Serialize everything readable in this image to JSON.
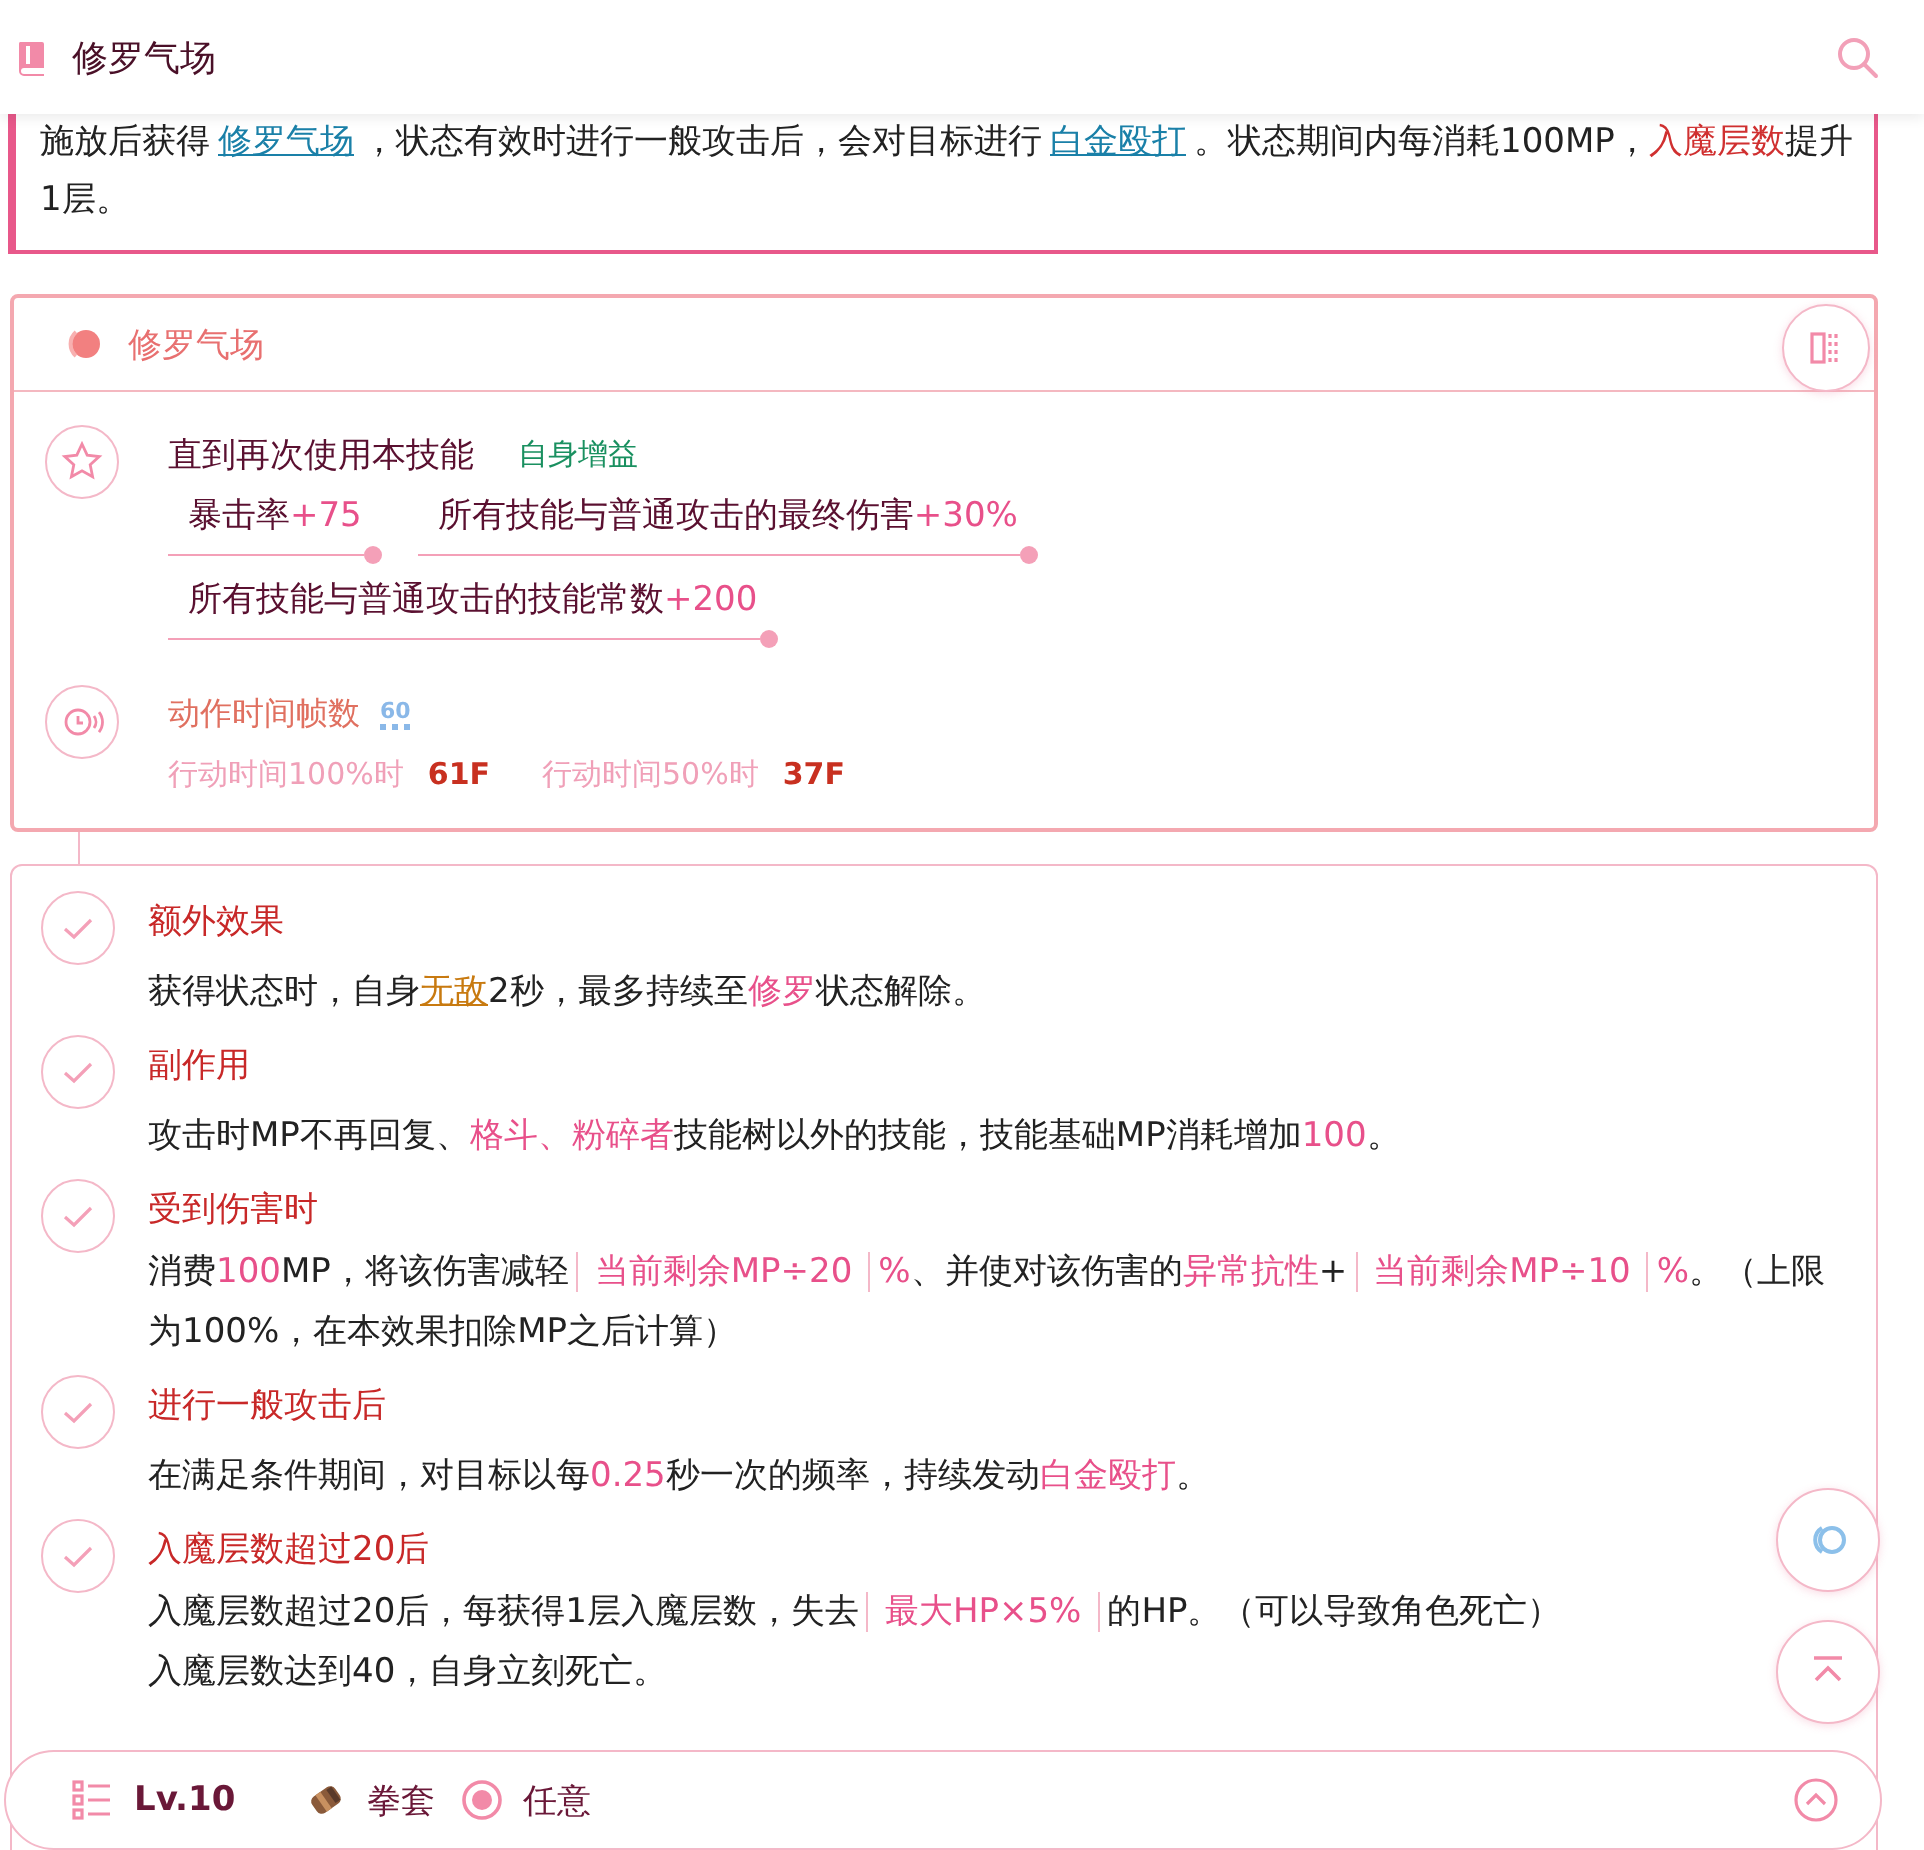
{
  "header": {
    "title": "修罗气场"
  },
  "description": [
    {
      "kind": "text",
      "text": "施放后获得"
    },
    {
      "kind": "link",
      "text": "修罗气场"
    },
    {
      "kind": "text",
      "text": "，状态有效时进行一般攻击后，会对目标进行"
    },
    {
      "kind": "link",
      "text": "白金殴打"
    },
    {
      "kind": "text",
      "text": "。状态期间内每消耗100MP，"
    },
    {
      "kind": "red",
      "text": "入魔层数"
    },
    {
      "kind": "text",
      "text": "提升1层。"
    }
  ],
  "skill_card": {
    "title": "修罗气场",
    "effect": {
      "duration": "直到再次使用本技能",
      "tag": "自身增益",
      "stats": [
        {
          "label": "暴击率",
          "value": "+75"
        },
        {
          "label": "所有技能与普通攻击的最终伤害",
          "value": "+30%"
        },
        {
          "label": "所有技能与普通攻击的技能常数",
          "value": "+200"
        }
      ]
    },
    "frames": {
      "label": "动作时间帧数",
      "badge": "60",
      "rows": [
        {
          "label": "行动时间100%时",
          "value": "61F"
        },
        {
          "label": "行动时间50%时",
          "value": "37F"
        }
      ]
    }
  },
  "details": [
    {
      "title": "额外效果",
      "lines": [
        [
          {
            "kind": "text",
            "text": "获得状态时，自身"
          },
          {
            "kind": "warn-link",
            "text": "无敌"
          },
          {
            "kind": "text",
            "text": "2秒，最多持续至"
          },
          {
            "kind": "pink",
            "text": "修罗"
          },
          {
            "kind": "text",
            "text": "状态解除。"
          }
        ]
      ]
    },
    {
      "title": "副作用",
      "lines": [
        [
          {
            "kind": "text",
            "text": "攻击时MP不再回复、"
          },
          {
            "kind": "pink",
            "text": "格斗、粉碎者"
          },
          {
            "kind": "text",
            "text": "技能树以外的技能，技能基础MP消耗增加"
          },
          {
            "kind": "pink",
            "text": "100"
          },
          {
            "kind": "text",
            "text": "。"
          }
        ]
      ]
    },
    {
      "title": "受到伤害时",
      "lines": [
        [
          {
            "kind": "text",
            "text": "消费"
          },
          {
            "kind": "pink",
            "text": "100"
          },
          {
            "kind": "text",
            "text": "MP，将该伤害减轻"
          },
          {
            "kind": "formula",
            "text": "当前剩余MP÷20"
          },
          {
            "kind": "pink",
            "text": "%"
          },
          {
            "kind": "text",
            "text": "、并使对该伤害的"
          },
          {
            "kind": "pink",
            "text": "异常抗性"
          },
          {
            "kind": "text",
            "text": "+"
          },
          {
            "kind": "formula",
            "text": "当前剩余MP÷10"
          },
          {
            "kind": "pink",
            "text": "%"
          },
          {
            "kind": "text",
            "text": "。（上限为100%，在本效果扣除MP之后计算）"
          }
        ]
      ]
    },
    {
      "title": "进行一般攻击后",
      "lines": [
        [
          {
            "kind": "text",
            "text": "在满足条件期间，对目标以每"
          },
          {
            "kind": "pink",
            "text": "0.25"
          },
          {
            "kind": "text",
            "text": "秒一次的频率，持续发动"
          },
          {
            "kind": "pink",
            "text": "白金殴打"
          },
          {
            "kind": "text",
            "text": "。"
          }
        ]
      ]
    },
    {
      "title": "入魔层数超过20后",
      "lines": [
        [
          {
            "kind": "text",
            "text": "入魔层数超过20后，每获得1层入魔层数，失去"
          },
          {
            "kind": "formula",
            "text": "最大HP×5%"
          },
          {
            "kind": "text",
            "text": "的HP。（可以导致角色死亡）"
          }
        ],
        [
          {
            "kind": "text",
            "text": "入魔层数达到40，自身立刻死亡。"
          }
        ]
      ]
    }
  ],
  "footer": {
    "level": "Lv.10",
    "weapon": "拳套",
    "condition": "任意"
  }
}
